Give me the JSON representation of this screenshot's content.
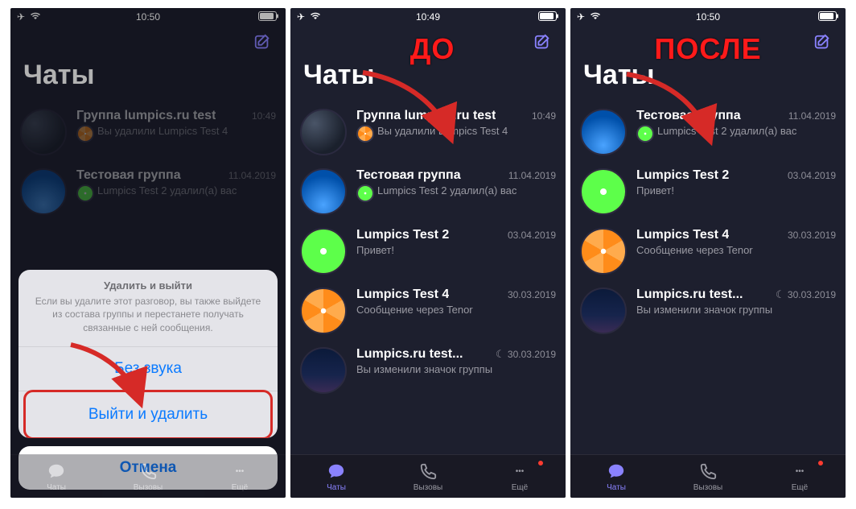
{
  "statusbar": {
    "time1": "10:50",
    "time2": "10:49",
    "time3": "10:50"
  },
  "compose_aria": "Написать",
  "page_title": "Чаты",
  "overlay": {
    "before": "ДО",
    "after": "ПОСЛЕ"
  },
  "sheet": {
    "title": "Удалить и выйти",
    "desc": "Если вы удалите этот разговор, вы также выйдете из состава группы и перестанете получать связанные с ней сообщения.",
    "mute": "Без звука",
    "leave": "Выйти и удалить",
    "cancel": "Отмена"
  },
  "tabs": {
    "chats": "Чаты",
    "calls": "Вызовы",
    "more": "Ещё"
  },
  "p1": {
    "rows": [
      {
        "name": "Группа lumpics.ru test",
        "time": "10:49",
        "snippet": "Вы удалили Lumpics Test 4",
        "avatar": "av-planet",
        "mini": "av-orange"
      },
      {
        "name": "Тестовая группа",
        "time": "11.04.2019",
        "snippet": "Lumpics Test 2 удалил(а) вас",
        "avatar": "av-wave",
        "mini": "av-lime"
      }
    ]
  },
  "p2": {
    "rows": [
      {
        "name": "Группа lumpics.ru test",
        "time": "10:49",
        "snippet": "Вы удалили Lumpics Test 4",
        "avatar": "av-planet",
        "mini": "av-orange"
      },
      {
        "name": "Тестовая группа",
        "time": "11.04.2019",
        "snippet": "Lumpics Test 2 удалил(а) вас",
        "avatar": "av-wave",
        "mini": "av-lime"
      },
      {
        "name": "Lumpics Test 2",
        "time": "03.04.2019",
        "snippet": "Привет!",
        "avatar": "av-lime"
      },
      {
        "name": "Lumpics Test 4",
        "time": "30.03.2019",
        "snippet": "Сообщение через Tenor",
        "avatar": "av-orange"
      },
      {
        "name": "Lumpics.ru test...",
        "time": "30.03.2019",
        "snippet": "Вы изменили значок группы",
        "avatar": "av-night",
        "moon": true
      }
    ]
  },
  "p3": {
    "rows": [
      {
        "name": "Тестовая группа",
        "time": "11.04.2019",
        "snippet": "Lumpics Test 2 удалил(а) вас",
        "avatar": "av-wave",
        "mini": "av-lime"
      },
      {
        "name": "Lumpics Test 2",
        "time": "03.04.2019",
        "snippet": "Привет!",
        "avatar": "av-lime"
      },
      {
        "name": "Lumpics Test 4",
        "time": "30.03.2019",
        "snippet": "Сообщение через Tenor",
        "avatar": "av-orange"
      },
      {
        "name": "Lumpics.ru test...",
        "time": "30.03.2019",
        "snippet": "Вы изменили значок группы",
        "avatar": "av-night",
        "moon": true
      }
    ]
  }
}
